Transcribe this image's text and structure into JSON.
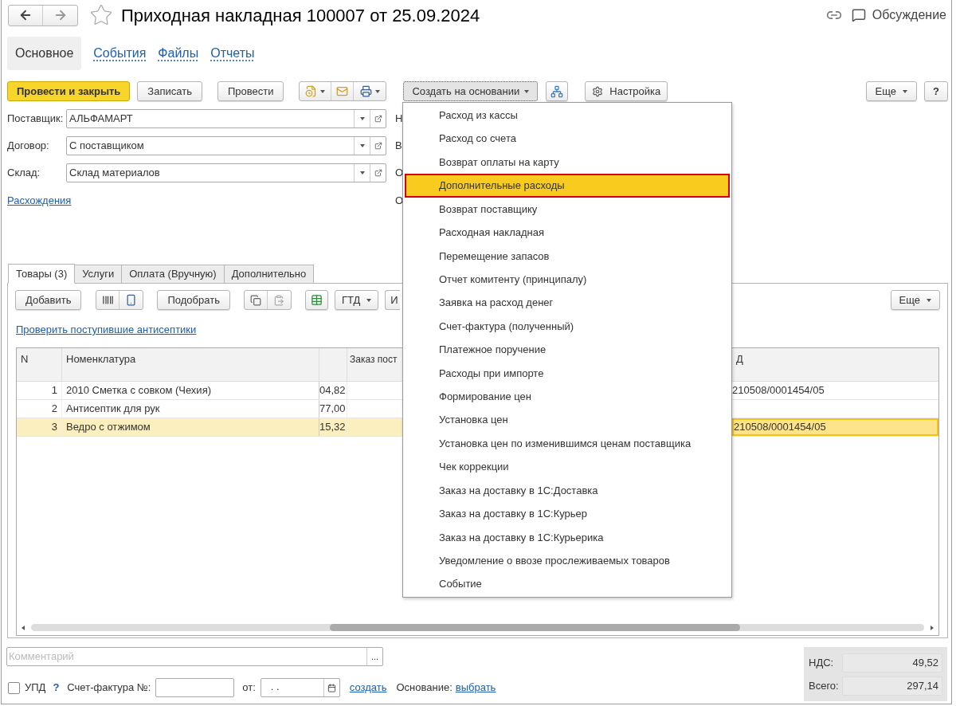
{
  "window": {
    "title": "Приходная накладная 100007 от 25.09.2024",
    "discussion": "Обсуждение"
  },
  "nav_tabs": [
    {
      "label": "Основное",
      "selected": true
    },
    {
      "label": "События",
      "selected": false
    },
    {
      "label": "Файлы",
      "selected": false
    },
    {
      "label": "Отчеты",
      "selected": false
    }
  ],
  "toolbar": {
    "post_and_close": "Провести и закрыть",
    "save": "Записать",
    "post": "Провести",
    "create_based_on": {
      "label": "Создать на основании",
      "expanded": true
    },
    "settings": "Настройка",
    "more": "Еще",
    "help": "?"
  },
  "fields": [
    {
      "label": "Поставщик:",
      "value": "АЛЬФАМАРТ",
      "side": "Н"
    },
    {
      "label": "Договор:",
      "value": "С поставщиком",
      "side": "В"
    },
    {
      "label": "Склад:",
      "value": "Склад материалов",
      "side": "О"
    }
  ],
  "discrepancies": {
    "link": "Расхождения",
    "side": "О"
  },
  "doc_tabs": [
    {
      "label": "Товары (3)",
      "selected": true
    },
    {
      "label": "Услуги",
      "selected": false
    },
    {
      "label": "Оплата (Вручную)",
      "selected": false
    },
    {
      "label": "Дополнительно",
      "selected": false
    }
  ],
  "table_toolbar": {
    "add": "Добавить",
    "pick": "Подобрать",
    "gtd": "ГТД",
    "column_5": "И",
    "more": "Еще"
  },
  "check_link": "Проверить поступившие антисептики",
  "table": {
    "columns": {
      "n": "N",
      "nomenclature": "Номенклатура",
      "column_4": "Заказ пост",
      "column_6": "Д"
    },
    "rows": [
      {
        "n": "1",
        "nomenclature": "2010 Сметка с совком (Чехия)",
        "column_3": "04,82",
        "column_6": "210508/0001454/05",
        "selected": false
      },
      {
        "n": "2",
        "nomenclature": "Антисептик для рук",
        "column_3": "77,00",
        "selected": false
      },
      {
        "n": "3",
        "nomenclature": "Ведро с отжимом",
        "column_3": "15,32",
        "column_6": "210508/0001454/05",
        "selected": true
      }
    ]
  },
  "menu": [
    {
      "label": "Расход из кассы",
      "selected": false
    },
    {
      "label": "Расход со счета",
      "selected": false
    },
    {
      "label": "Возврат оплаты на карту",
      "selected": false
    },
    {
      "label": "Дополнительные расходы",
      "selected": true
    },
    {
      "label": "Возврат поставщику",
      "selected": false
    },
    {
      "label": "Расходная накладная",
      "selected": false
    },
    {
      "label": "Перемещение запасов",
      "selected": false
    },
    {
      "label": "Отчет комитенту (принципалу)",
      "selected": false
    },
    {
      "label": "Заявка на расход денег",
      "selected": false
    },
    {
      "label": "Счет-фактура (полученный)",
      "selected": false
    },
    {
      "label": "Платежное поручение",
      "selected": false
    },
    {
      "label": "Расходы при импорте",
      "selected": false
    },
    {
      "label": "Формирование цен",
      "selected": false
    },
    {
      "label": "Установка цен",
      "selected": false
    },
    {
      "label": "Установка цен по изменившимся ценам поставщика",
      "selected": false
    },
    {
      "label": "Чек коррекции",
      "selected": false
    },
    {
      "label": "Заказ на доставку в 1С:Доставка",
      "selected": false
    },
    {
      "label": "Заказ на доставку в 1С:Курьер",
      "selected": false
    },
    {
      "label": "Заказ на доставку в 1С:Курьерика",
      "selected": false
    },
    {
      "label": "Уведомление о ввозе прослеживаемых товаров",
      "selected": false
    },
    {
      "label": "Событие",
      "selected": false
    }
  ],
  "comment": {
    "placeholder": "Комментарий",
    "button": "..."
  },
  "footer": {
    "upd": {
      "label": "УПД",
      "checked": false
    },
    "help": "?",
    "invoice_label": "Счет-фактура №:",
    "from_label": "от:",
    "date_value": ". .",
    "create_link": "создать",
    "basis_label": "Основание:",
    "basis_link": "выбрать"
  },
  "totals": [
    {
      "label": "НДС:",
      "value": "49,52"
    },
    {
      "label": "Всего:",
      "value": "297,14"
    }
  ]
}
